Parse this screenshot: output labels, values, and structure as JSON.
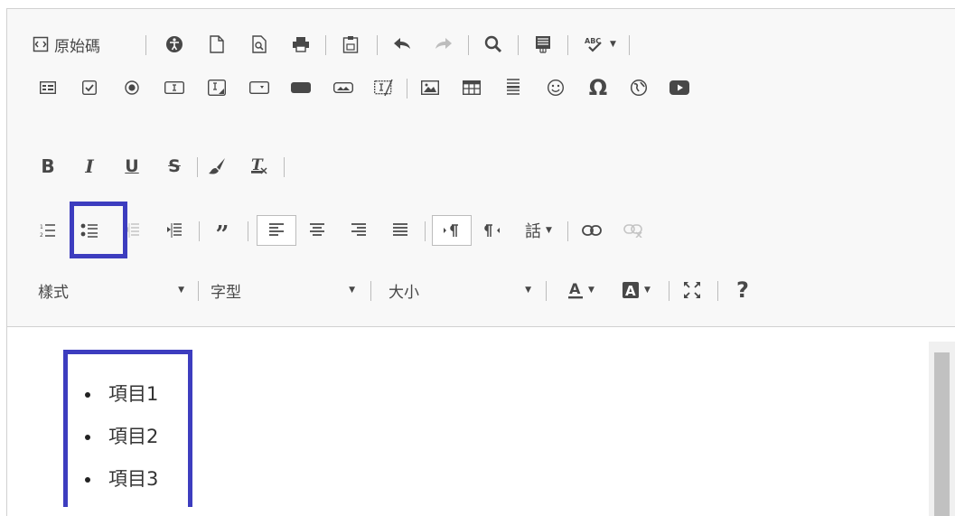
{
  "toolbar": {
    "source_label": "原始碼",
    "style_combo": "樣式",
    "font_combo": "字型",
    "size_combo": "大小"
  },
  "content": {
    "items": [
      "項目1",
      "項目2",
      "項目3"
    ]
  },
  "colors": {
    "highlight": "#3d3dbf",
    "toolbar_bg": "#f8f8f8",
    "icon": "#484848"
  }
}
